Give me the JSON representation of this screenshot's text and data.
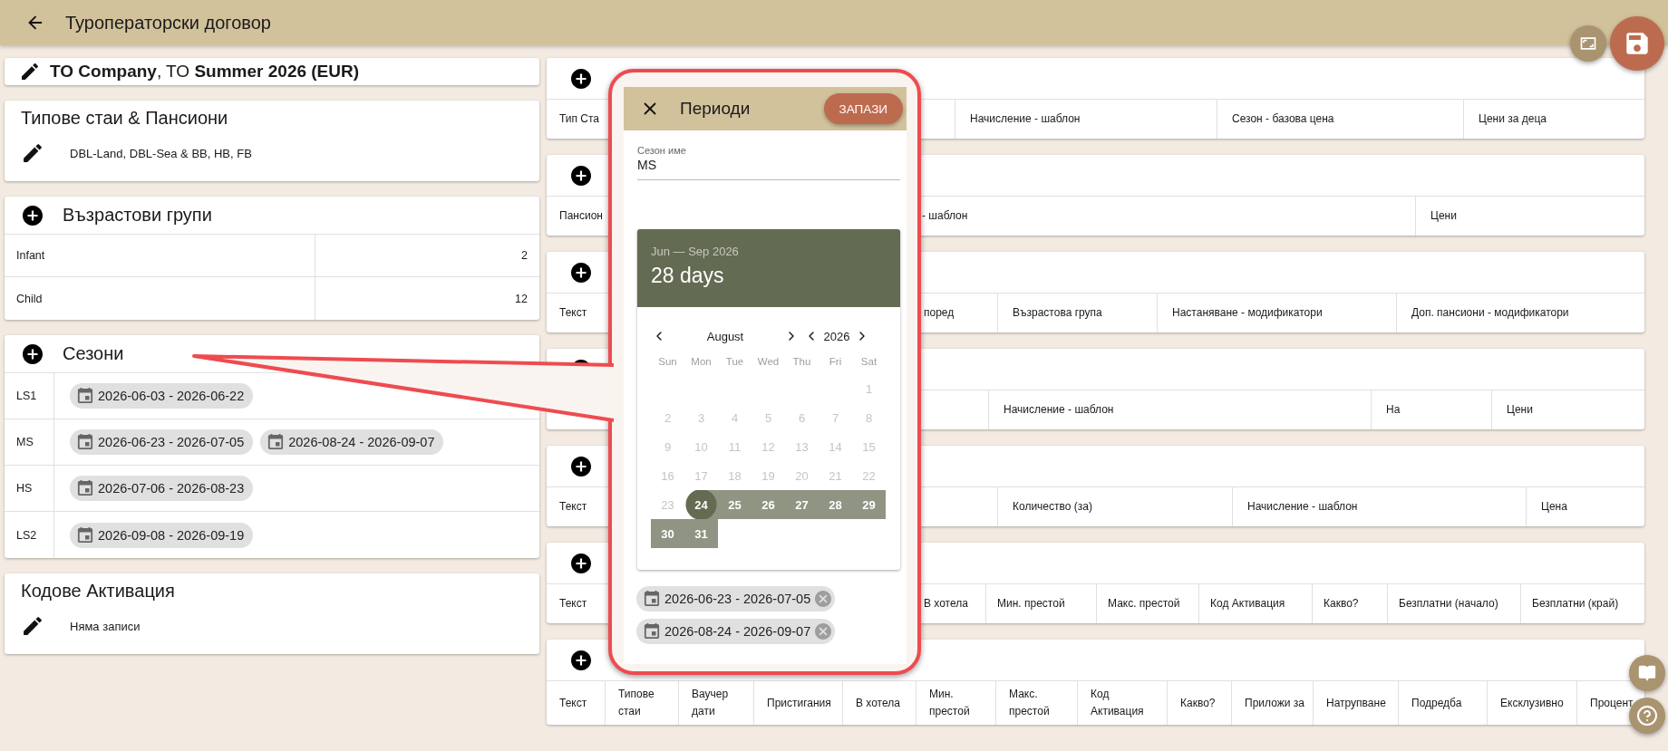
{
  "app_bar": {
    "title": "Туроператорски договор"
  },
  "contract": {
    "title": "**TO Company**, TO **Summer 2026 (EUR)**"
  },
  "room_types": {
    "title": "Типове стаи & Пансиони",
    "summary": "DBL-Land, DBL-Sea & BB, HB, FB"
  },
  "age_groups": {
    "title": "Възрастови групи",
    "rows": [
      {
        "name": "Infant",
        "age": "2"
      },
      {
        "name": "Child",
        "age": "12"
      }
    ]
  },
  "seasons": {
    "title": "Сезони",
    "rows": [
      {
        "name": "LS1",
        "periods": [
          "2026-06-03 - 2026-06-22"
        ]
      },
      {
        "name": "MS",
        "periods": [
          "2026-06-23 - 2026-07-05",
          "2026-08-24 - 2026-09-07"
        ]
      },
      {
        "name": "HS",
        "periods": [
          "2026-07-06 - 2026-08-23"
        ]
      },
      {
        "name": "LS2",
        "periods": [
          "2026-09-08 - 2026-09-19"
        ]
      }
    ]
  },
  "activation_codes": {
    "title": "Кодове Активация",
    "summary": "Няма записи"
  },
  "tables": [
    {
      "columns": [
        "Тип Ста",
        "Начисление - шаблон",
        "Сезон - базова цена",
        "Цени за деца"
      ]
    },
    {
      "columns": [
        "Пансион",
        "- шаблон",
        "Цени"
      ]
    },
    {
      "columns": [
        "Текст",
        "поред",
        "Възрастова група",
        "Настаняване - модификатори",
        "Доп. пансиони - модификатори"
      ]
    },
    {
      "columns": [
        "Начисление - шаблон",
        "На",
        "Цени"
      ]
    },
    {
      "columns": [
        "Текст",
        "Количество (за)",
        "Начисление - шаблон",
        "Цена"
      ]
    },
    {
      "columns": [
        "Текст",
        "В хотела",
        "Мин. престой",
        "Макс. престой",
        "Код Активация",
        "Какво?",
        "Безплатни (начало)",
        "Безплатни (край)"
      ]
    },
    {
      "columns": [
        "Текст",
        "Типове стаи",
        "Ваучер дати",
        "Пристигания",
        "В хотела",
        "Мин. престой",
        "Макс. престой",
        "Код Активация",
        "Какво?",
        "Приложи за",
        "Натрупване",
        "Подредба",
        "Ексклузивно",
        "Процент"
      ]
    }
  ],
  "dialog": {
    "title": "Периоди",
    "save": "ЗАПАЗИ",
    "field": {
      "label": "Сезон име",
      "value": "MS"
    },
    "calendar": {
      "range": "Jun — Sep 2026",
      "days_count": "28 days",
      "month": "August",
      "year": "2026",
      "weekdays": [
        "Sun",
        "Mon",
        "Tue",
        "Wed",
        "Thu",
        "Fri",
        "Sat"
      ],
      "weeks": [
        [
          {
            "d": "1",
            "disabled": true,
            "in_range": false,
            "selected": false
          }
        ],
        [
          {
            "d": "2",
            "disabled": true,
            "in_range": false,
            "selected": false
          },
          {
            "d": "3",
            "disabled": true,
            "in_range": false,
            "selected": false
          },
          {
            "d": "4",
            "disabled": true,
            "in_range": false,
            "selected": false
          },
          {
            "d": "5",
            "disabled": true,
            "in_range": false,
            "selected": false
          },
          {
            "d": "6",
            "disabled": true,
            "in_range": false,
            "selected": false
          },
          {
            "d": "7",
            "disabled": true,
            "in_range": false,
            "selected": false
          },
          {
            "d": "8",
            "disabled": true,
            "in_range": false,
            "selected": false
          }
        ],
        [
          {
            "d": "9",
            "disabled": true,
            "in_range": false,
            "selected": false
          },
          {
            "d": "10",
            "disabled": true,
            "in_range": false,
            "selected": false
          },
          {
            "d": "11",
            "disabled": true,
            "in_range": false,
            "selected": false
          },
          {
            "d": "12",
            "disabled": true,
            "in_range": false,
            "selected": false
          },
          {
            "d": "13",
            "disabled": true,
            "in_range": false,
            "selected": false
          },
          {
            "d": "14",
            "disabled": true,
            "in_range": false,
            "selected": false
          },
          {
            "d": "15",
            "disabled": true,
            "in_range": false,
            "selected": false
          }
        ],
        [
          {
            "d": "16",
            "disabled": true,
            "in_range": false,
            "selected": false
          },
          {
            "d": "17",
            "disabled": true,
            "in_range": false,
            "selected": false
          },
          {
            "d": "18",
            "disabled": true,
            "in_range": false,
            "selected": false
          },
          {
            "d": "19",
            "disabled": true,
            "in_range": false,
            "selected": false
          },
          {
            "d": "20",
            "disabled": true,
            "in_range": false,
            "selected": false
          },
          {
            "d": "21",
            "disabled": true,
            "in_range": false,
            "selected": false
          },
          {
            "d": "22",
            "disabled": true,
            "in_range": false,
            "selected": false
          }
        ],
        [
          {
            "d": "23",
            "disabled": true,
            "in_range": false,
            "selected": false
          },
          {
            "d": "24",
            "disabled": false,
            "in_range": false,
            "selected": true
          },
          {
            "d": "25",
            "disabled": false,
            "in_range": true,
            "selected": false
          },
          {
            "d": "26",
            "disabled": false,
            "in_range": true,
            "selected": false
          },
          {
            "d": "27",
            "disabled": false,
            "in_range": true,
            "selected": false
          },
          {
            "d": "28",
            "disabled": false,
            "in_range": true,
            "selected": false
          },
          {
            "d": "29",
            "disabled": false,
            "in_range": true,
            "selected": false
          }
        ],
        [
          {
            "d": "30",
            "disabled": false,
            "in_range": true,
            "selected": false
          },
          {
            "d": "31",
            "disabled": false,
            "in_range": true,
            "selected": false
          }
        ]
      ]
    },
    "periods": [
      "2026-06-23 - 2026-07-05",
      "2026-08-24 - 2026-09-07"
    ]
  }
}
